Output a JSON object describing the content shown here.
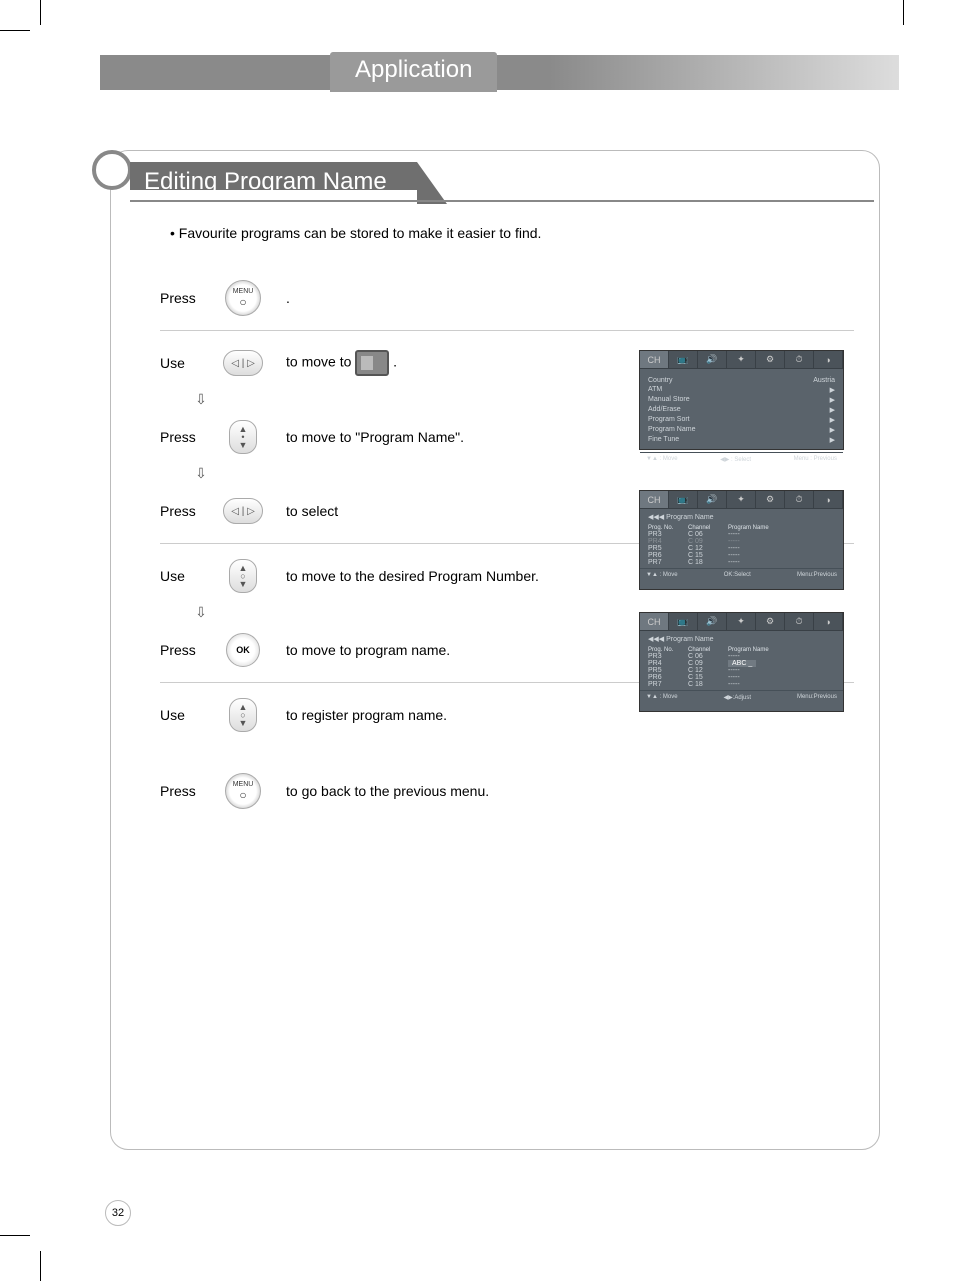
{
  "header": {
    "title": "Application"
  },
  "section": {
    "title": "Editing Program Name"
  },
  "intro": "• Favourite programs can be stored to make it easier to find.",
  "steps": {
    "s1": {
      "action": "Press",
      "icon_label": "MENU",
      "desc": "."
    },
    "s2": {
      "action": "Use",
      "desc_pre": "to move to ",
      "desc_post": "."
    },
    "s3": {
      "action": "Press",
      "desc": "to move to \"Program Name\"."
    },
    "s4": {
      "action": "Press",
      "desc": "to select"
    },
    "s5": {
      "action": "Use",
      "desc": "to  move to the desired Program Number."
    },
    "s6": {
      "action": "Press",
      "icon_label": "OK",
      "desc": "to move to program name."
    },
    "s7": {
      "action": "Use",
      "desc": "to register program name."
    },
    "s8": {
      "action": "Press",
      "icon_label": "MENU",
      "desc": "to go back to the previous menu."
    }
  },
  "osd1": {
    "tab": "CH",
    "items": [
      {
        "k": "Country",
        "v": "Austria"
      },
      {
        "k": "ATM",
        "v": ""
      },
      {
        "k": "Manual Store",
        "v": ""
      },
      {
        "k": "Add/Erase",
        "v": ""
      },
      {
        "k": "Program Sort",
        "v": ""
      },
      {
        "k": "Program Name",
        "v": ""
      },
      {
        "k": "Fine Tune",
        "v": ""
      }
    ],
    "footer": {
      "l": "▼▲ : Move",
      "c": "◀▶ : Select",
      "r": "Menu : Previous"
    }
  },
  "osd2": {
    "tab": "CH",
    "subtitle": "◀◀◀   Program Name",
    "cols": [
      "Prog. No.",
      "Channel",
      "Program Name"
    ],
    "rows": [
      {
        "p": "PR3",
        "c": "C 06",
        "n": "-----"
      },
      {
        "p": "PR4",
        "c": "C 09",
        "n": "-----",
        "dim": true
      },
      {
        "p": "PR5",
        "c": "C 12",
        "n": "-----"
      },
      {
        "p": "PR6",
        "c": "C 15",
        "n": "-----"
      },
      {
        "p": "PR7",
        "c": "C 18",
        "n": "-----"
      }
    ],
    "footer": {
      "l": "▼▲ : Move",
      "c": "OK:Select",
      "r": "Menu:Previous"
    }
  },
  "osd3": {
    "tab": "CH",
    "subtitle": "◀◀◀   Program Name",
    "cols": [
      "Prog. No.",
      "Channel",
      "Program Name"
    ],
    "rows": [
      {
        "p": "PR3",
        "c": "C 06",
        "n": "-----"
      },
      {
        "p": "PR4",
        "c": "C 09",
        "n": "ABC _",
        "hl": true
      },
      {
        "p": "PR5",
        "c": "C 12",
        "n": "-----"
      },
      {
        "p": "PR6",
        "c": "C 15",
        "n": "-----"
      },
      {
        "p": "PR7",
        "c": "C 18",
        "n": "-----"
      }
    ],
    "footer": {
      "l": "▼▲ : Move",
      "c": "◀▶:Adjust",
      "r": "Menu:Previous"
    }
  },
  "page": "32"
}
